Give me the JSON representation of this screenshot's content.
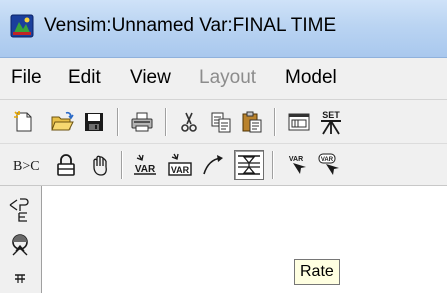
{
  "window": {
    "title": "Vensim:Unnamed Var:FINAL TIME"
  },
  "menu": {
    "items": [
      {
        "label": "File",
        "enabled": true
      },
      {
        "label": "Edit",
        "enabled": true
      },
      {
        "label": "View",
        "enabled": true
      },
      {
        "label": "Layout",
        "enabled": false
      },
      {
        "label": "Model",
        "enabled": true
      }
    ]
  },
  "toolbar1": {
    "icons": [
      "new-model-icon",
      "open-model-icon",
      "save-icon",
      "print-icon",
      "cut-icon",
      "copy-icon",
      "paste-icon",
      "output-window-icon",
      "set-simulation-icon"
    ],
    "set_label": "SET"
  },
  "toolbar2": {
    "icons": [
      "word-edit-icon",
      "lock-icon",
      "move-hand-icon",
      "variable-icon",
      "box-variable-icon",
      "arrow-icon",
      "rate-icon",
      "shadow-variable-icon",
      "input-output-icon"
    ],
    "word_edit_label": "B>C",
    "variable_label": "VAR",
    "box_variable_label": "VAR",
    "shadow_variable_label": "VAR",
    "input_output_label": "VAR",
    "active_tool": "rate-icon"
  },
  "left_palette": {
    "icons": [
      "causes-tree-icon",
      "loops-icon",
      "document-icon"
    ]
  },
  "tooltip": {
    "text": "Rate"
  },
  "colors": {
    "titlebar": "#bad4f2",
    "chrome": "#f0f0f0",
    "tooltip_bg": "#ffffe1",
    "disabled_text": "#8c8c8c"
  }
}
